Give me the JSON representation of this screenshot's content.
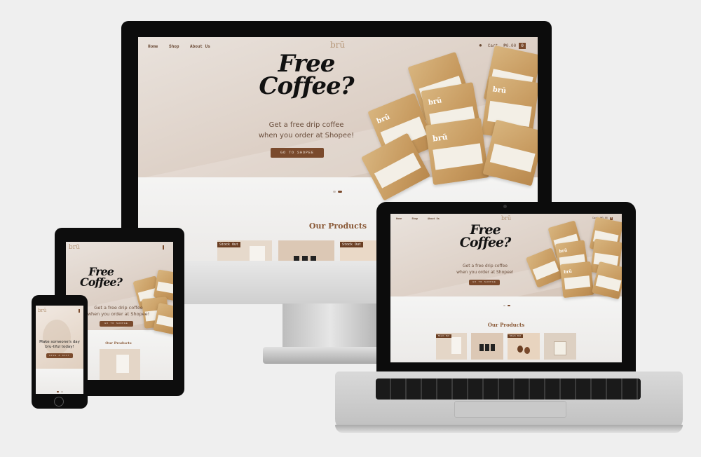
{
  "site": {
    "logo": "brū",
    "nav": [
      "Home",
      "Shop",
      "About Us"
    ],
    "cart_label": "Cart",
    "cart_total": "₱0.00",
    "cart_count": "0",
    "headline_line1": "Free",
    "headline_line2": "Coffee?",
    "subtext_line1": "Get a free drip coffee",
    "subtext_line2": "when you order at Shopee!",
    "cta_label": "GO TO SHOPEE",
    "products_title": "Our Products",
    "stock_out_label": "Stock Out",
    "bag_brand": "brū"
  },
  "phone_site": {
    "tagline_line1": "Make someone's day",
    "tagline_line2": "bru-tiful today!",
    "cta_label": "GIVE A GIFT"
  },
  "colors": {
    "accent": "#7a4a2c",
    "background": "#efefef",
    "hero": "#ddd0c6",
    "logo": "#b59678"
  }
}
